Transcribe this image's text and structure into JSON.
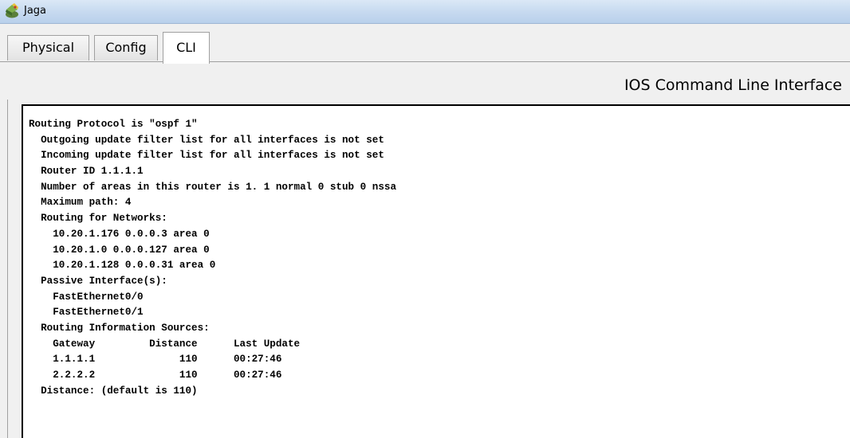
{
  "window": {
    "title": "Jaga",
    "icon": "packet-tracer-router-icon"
  },
  "tabs": [
    {
      "label": "Physical",
      "active": false
    },
    {
      "label": "Config",
      "active": false
    },
    {
      "label": "CLI",
      "active": true
    }
  ],
  "cli": {
    "heading": "IOS Command Line Interface",
    "lines": [
      "Routing Protocol is \"ospf 1\"",
      "  Outgoing update filter list for all interfaces is not set",
      "  Incoming update filter list for all interfaces is not set",
      "  Router ID 1.1.1.1",
      "  Number of areas in this router is 1. 1 normal 0 stub 0 nssa",
      "  Maximum path: 4",
      "  Routing for Networks:",
      "    10.20.1.176 0.0.0.3 area 0",
      "    10.20.1.0 0.0.0.127 area 0",
      "    10.20.1.128 0.0.0.31 area 0",
      "  Passive Interface(s):",
      "    FastEthernet0/0",
      "    FastEthernet0/1",
      "  Routing Information Sources:",
      "    Gateway         Distance      Last Update",
      "    1.1.1.1              110      00:27:46",
      "    2.2.2.2              110      00:27:46",
      "  Distance: (default is 110)"
    ]
  }
}
